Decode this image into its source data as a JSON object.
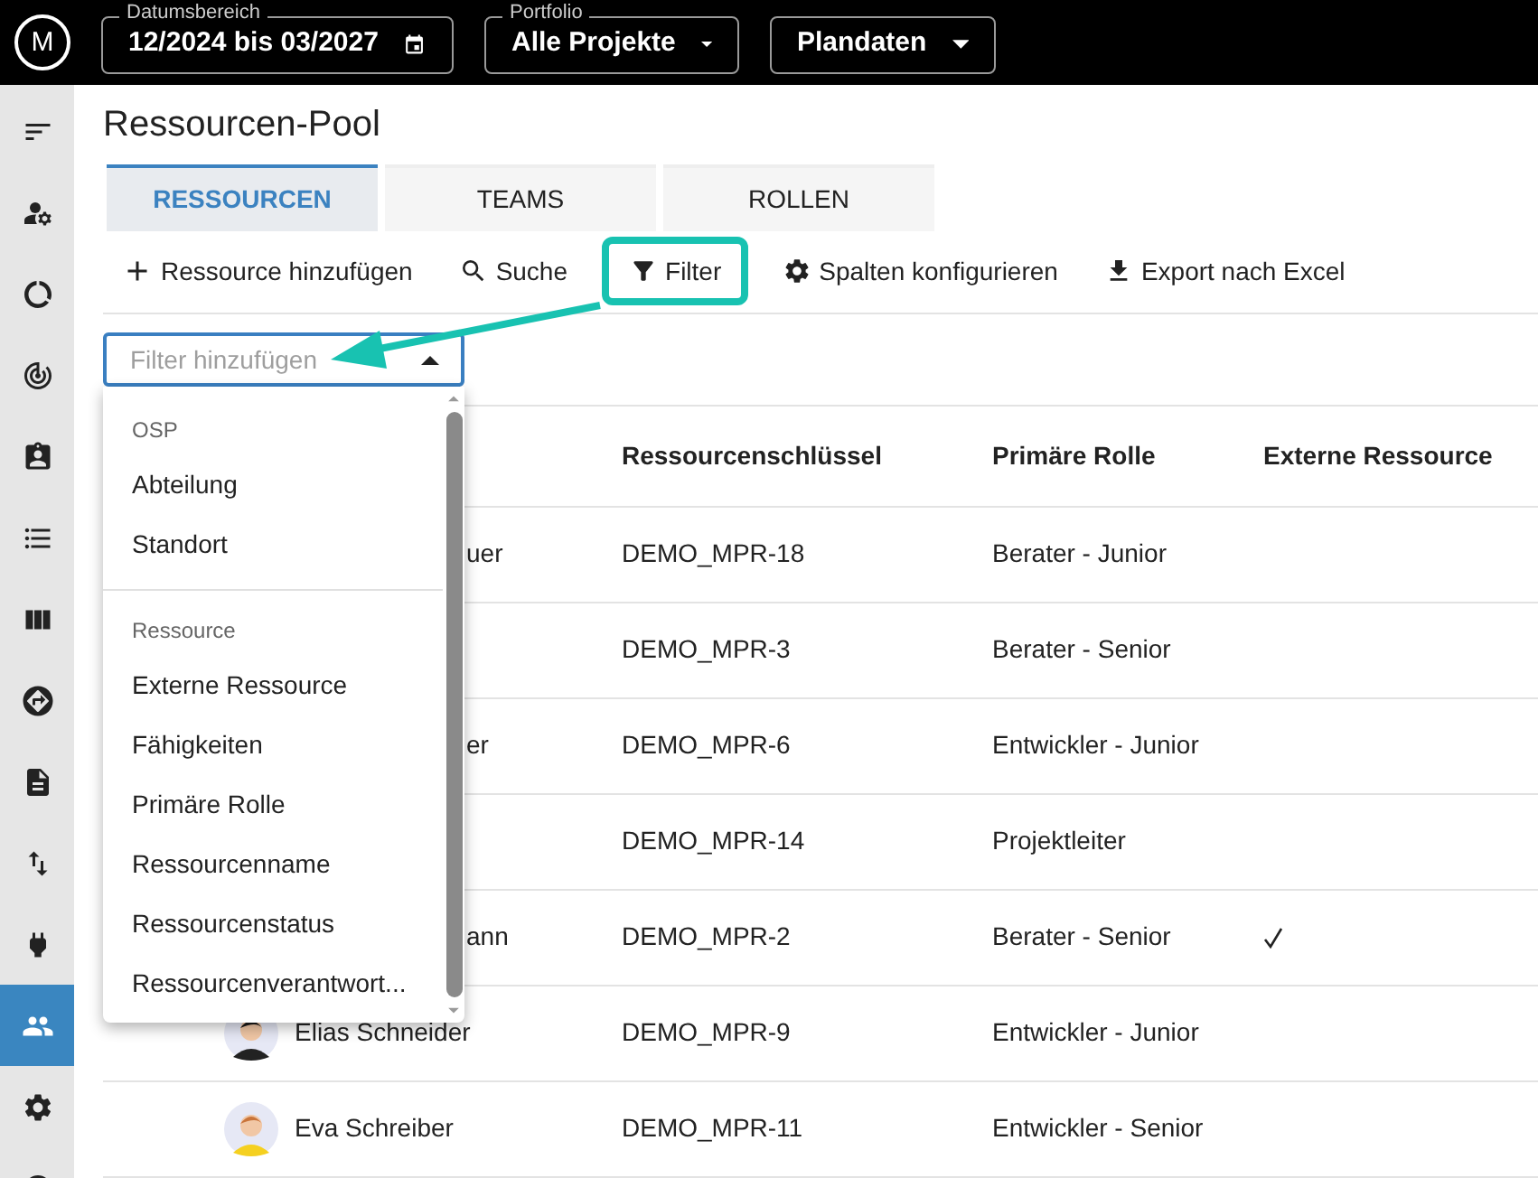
{
  "header": {
    "logo": "M",
    "fields": [
      {
        "kind": "date",
        "label": "Datumsbereich",
        "value": "12/2024 bis 03/2027"
      },
      {
        "kind": "select",
        "label": "Portfolio",
        "value": "Alle Projekte"
      },
      {
        "kind": "select",
        "value": "Plandaten"
      }
    ]
  },
  "sidebar": {
    "items": [
      {
        "selected": false
      },
      {
        "selected": false
      },
      {
        "selected": false
      },
      {
        "selected": false
      },
      {
        "selected": false
      },
      {
        "selected": false
      },
      {
        "selected": false
      },
      {
        "selected": false
      },
      {
        "selected": false
      },
      {
        "selected": false
      },
      {
        "selected": false
      },
      {
        "selected": true
      },
      {
        "selected": false
      },
      {
        "selected": false
      }
    ]
  },
  "page_title": "Ressourcen-Pool",
  "tabs": [
    {
      "label": "RESSOURCEN",
      "selected": true
    },
    {
      "label": "TEAMS",
      "selected": false
    },
    {
      "label": "ROLLEN",
      "selected": false
    }
  ],
  "toolbar": [
    {
      "kind": "add",
      "label": "Ressource hinzufügen",
      "highlighted": false
    },
    {
      "kind": "search",
      "label": "Suche",
      "highlighted": false
    },
    {
      "kind": "filter",
      "label": "Filter",
      "highlighted": true
    },
    {
      "kind": "columns",
      "label": "Spalten konfigurieren",
      "highlighted": false
    },
    {
      "kind": "export",
      "label": "Export nach Excel",
      "highlighted": false
    }
  ],
  "filter_field": {
    "placeholder": "Filter hinzufügen",
    "expanded": true
  },
  "filter_menu": [
    {
      "heading": "OSP",
      "items": [
        "Abteilung",
        "Standort"
      ]
    },
    {
      "heading": "Ressource",
      "items": [
        "Externe Ressource",
        "Fähigkeiten",
        "Primäre Rolle",
        "Ressourcenname",
        "Ressourcenstatus",
        "Ressourcenverantwort..."
      ]
    }
  ],
  "table": {
    "columns": [
      "Ressourcenschlüssel",
      "Primäre Rolle",
      "Externe Ressource"
    ],
    "rows": [
      {
        "name": "uer",
        "avatar": false,
        "key": "DEMO_MPR-18",
        "role": "Berater - Junior",
        "external": false
      },
      {
        "key": "DEMO_MPR-3",
        "role": "Berater - Senior",
        "external": false
      },
      {
        "name": "er",
        "avatar": false,
        "key": "DEMO_MPR-6",
        "role": "Entwickler - Junior",
        "external": false
      },
      {
        "key": "DEMO_MPR-14",
        "role": "Projektleiter",
        "external": false
      },
      {
        "name": "ann",
        "avatar": false,
        "key": "DEMO_MPR-2",
        "role": "Berater - Senior",
        "external": true
      },
      {
        "name": "Elias Schneider",
        "avatar": true,
        "key": "DEMO_MPR-9",
        "role": "Entwickler - Junior",
        "external": false
      },
      {
        "name": "Eva Schreiber",
        "avatar": true,
        "key": "DEMO_MPR-11",
        "role": "Entwickler - Senior",
        "external": false
      }
    ]
  }
}
